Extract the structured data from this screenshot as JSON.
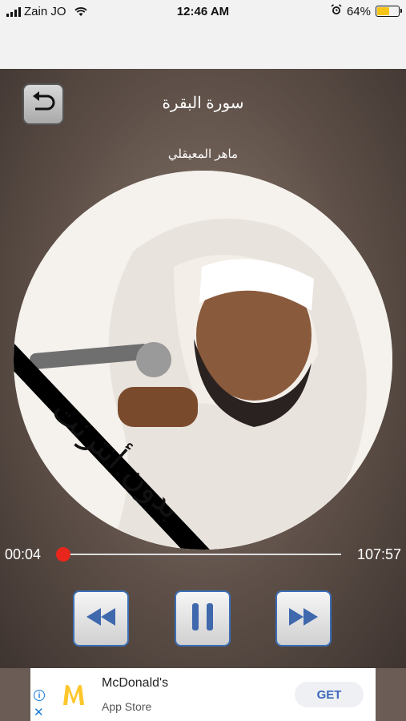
{
  "status_bar": {
    "carrier": "Zain JO",
    "time": "12:46 AM",
    "battery_text": "64%",
    "battery_level": 0.64
  },
  "player": {
    "surah_title": "سورة البقرة",
    "reciter_name": "ماهر المعيقلي",
    "cover_banner": "بدون أنترنت",
    "current_time": "00:04",
    "total_time": "107:57",
    "progress": 0.0
  },
  "ad": {
    "app_name": "McDonald's",
    "store": "App Store",
    "get_label": "GET",
    "accent_color": "#3b68b9",
    "logo_color": "#ffc72c"
  },
  "icons": [
    "back-arrow-icon",
    "rewind-icon",
    "pause-icon",
    "fast-forward-icon",
    "info-icon",
    "close-icon"
  ]
}
